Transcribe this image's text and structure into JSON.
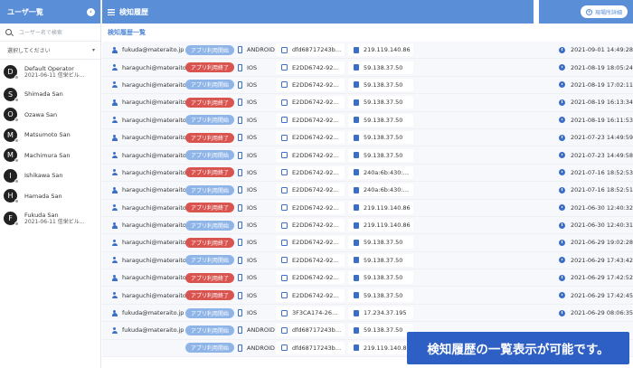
{
  "sidebar": {
    "title": "ユーザ一覧",
    "search_placeholder": "ユーザー名で検索",
    "select_label": "選択してください",
    "users": [
      {
        "initial": "D",
        "name": "Default Operator",
        "sub": "2021-06-11 信栄ビル…"
      },
      {
        "initial": "S",
        "name": "Shimada San",
        "sub": ""
      },
      {
        "initial": "O",
        "name": "Ozawa San",
        "sub": ""
      },
      {
        "initial": "M",
        "name": "Matsumoto San",
        "sub": ""
      },
      {
        "initial": "M",
        "name": "Machimura San",
        "sub": ""
      },
      {
        "initial": "I",
        "name": "Ishikawa San",
        "sub": ""
      },
      {
        "initial": "H",
        "name": "Hamada San",
        "sub": ""
      },
      {
        "initial": "F",
        "name": "Fukuda San",
        "sub": "2021-06-11 信栄ビル…"
      }
    ]
  },
  "main": {
    "title": "検知履歴",
    "subtitle": "検知履歴一覧",
    "detail_button": "現場所詳細",
    "rows": [
      {
        "email": "fukuda@materaito.jp",
        "status": "アプリ利用開始",
        "kind": "start",
        "os": "ANDROID",
        "device": "dfd68717243b…",
        "ip": "219.119.140.86",
        "time": "2021-09-01 14:49:28"
      },
      {
        "email": "haraguchi@materaito.jp",
        "status": "アプリ利用終了",
        "kind": "end",
        "os": "IOS",
        "device": "E2DD6742-92…",
        "ip": "59.138.37.50",
        "time": "2021-08-19 18:05:24"
      },
      {
        "email": "haraguchi@materaito.jp",
        "status": "アプリ利用開始",
        "kind": "start",
        "os": "IOS",
        "device": "E2DD6742-92…",
        "ip": "59.138.37.50",
        "time": "2021-08-19 17:02:11"
      },
      {
        "email": "haraguchi@materaito.jp",
        "status": "アプリ利用終了",
        "kind": "end",
        "os": "IOS",
        "device": "E2DD6742-92…",
        "ip": "59.138.37.50",
        "time": "2021-08-19 16:13:34"
      },
      {
        "email": "haraguchi@materaito.jp",
        "status": "アプリ利用開始",
        "kind": "start",
        "os": "IOS",
        "device": "E2DD6742-92…",
        "ip": "59.138.37.50",
        "time": "2021-08-19 16:11:53"
      },
      {
        "email": "haraguchi@materaito.jp",
        "status": "アプリ利用終了",
        "kind": "end",
        "os": "IOS",
        "device": "E2DD6742-92…",
        "ip": "59.138.37.50",
        "time": "2021-07-23 14:49:59"
      },
      {
        "email": "haraguchi@materaito.jp",
        "status": "アプリ利用開始",
        "kind": "start",
        "os": "IOS",
        "device": "E2DD6742-92…",
        "ip": "59.138.37.50",
        "time": "2021-07-23 14:49:58"
      },
      {
        "email": "haraguchi@materaito.jp",
        "status": "アプリ利用終了",
        "kind": "end",
        "os": "IOS",
        "device": "E2DD6742-92…",
        "ip": "240a:6b:430:…",
        "time": "2021-07-16 18:52:53"
      },
      {
        "email": "haraguchi@materaito.jp",
        "status": "アプリ利用開始",
        "kind": "start",
        "os": "IOS",
        "device": "E2DD6742-92…",
        "ip": "240a:6b:430:…",
        "time": "2021-07-16 18:52:51"
      },
      {
        "email": "haraguchi@materaito.jp",
        "status": "アプリ利用終了",
        "kind": "end",
        "os": "IOS",
        "device": "E2DD6742-92…",
        "ip": "219.119.140.86",
        "time": "2021-06-30 12:40:32"
      },
      {
        "email": "haraguchi@materaito.jp",
        "status": "アプリ利用開始",
        "kind": "start",
        "os": "IOS",
        "device": "E2DD6742-92…",
        "ip": "219.119.140.86",
        "time": "2021-06-30 12:40:31"
      },
      {
        "email": "haraguchi@materaito.jp",
        "status": "アプリ利用終了",
        "kind": "end",
        "os": "IOS",
        "device": "E2DD6742-92…",
        "ip": "59.138.37.50",
        "time": "2021-06-29 19:02:28"
      },
      {
        "email": "haraguchi@materaito.jp",
        "status": "アプリ利用開始",
        "kind": "start",
        "os": "IOS",
        "device": "E2DD6742-92…",
        "ip": "59.138.37.50",
        "time": "2021-06-29 17:43:42"
      },
      {
        "email": "haraguchi@materaito.jp",
        "status": "アプリ利用終了",
        "kind": "end",
        "os": "IOS",
        "device": "E2DD6742-92…",
        "ip": "59.138.37.50",
        "time": "2021-06-29 17:42:52"
      },
      {
        "email": "haraguchi@materaito.jp",
        "status": "アプリ利用終了",
        "kind": "end",
        "os": "IOS",
        "device": "E2DD6742-92…",
        "ip": "59.138.37.50",
        "time": "2021-06-29 17:42:45"
      },
      {
        "email": "fukuda@materaito.jp",
        "status": "アプリ利用開始",
        "kind": "start",
        "os": "IOS",
        "device": "3F3CA174-26…",
        "ip": "17.234.37.195",
        "time": "2021-06-29 08:06:35"
      },
      {
        "email": "fukuda@materaito.jp",
        "status": "アプリ利用開始",
        "kind": "start",
        "os": "ANDROID",
        "device": "dfd68717243b…",
        "ip": "59.138.37.50",
        "time": ""
      },
      {
        "email": "",
        "status": "アプリ利用開始",
        "kind": "start",
        "os": "ANDROID",
        "device": "dfd68717243b…",
        "ip": "219.119.140.86",
        "time": ""
      }
    ]
  },
  "caption": "検知履歴の一覧表示が可能です。",
  "colors": {
    "header": "#5a8fd8",
    "start": "#8fb5e8",
    "end": "#d9534f",
    "caption": "#2d5fc4"
  }
}
